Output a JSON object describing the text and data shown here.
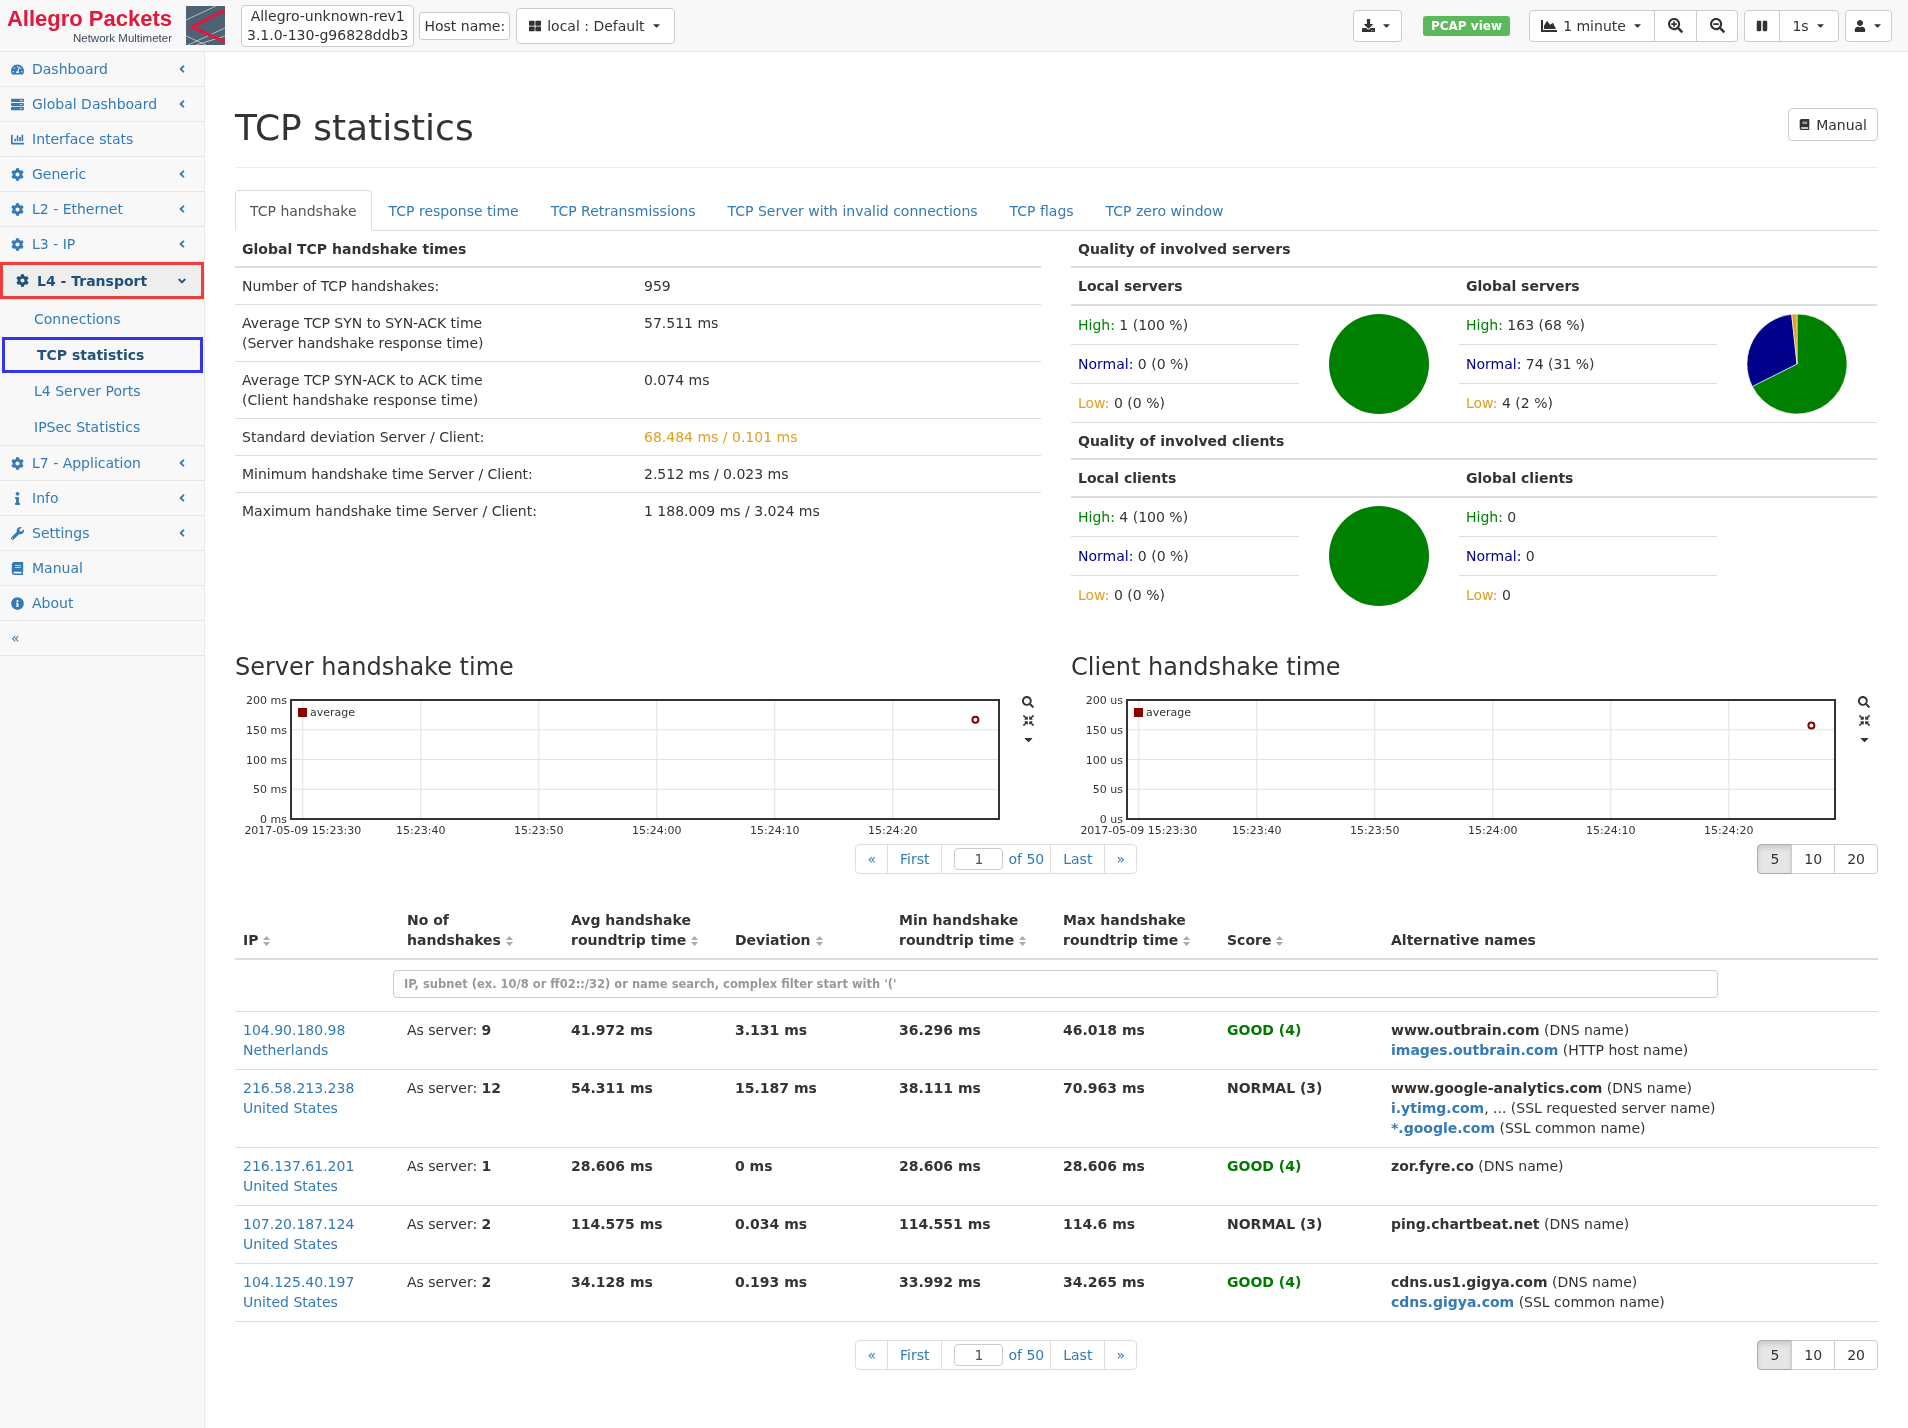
{
  "header": {
    "brand": {
      "name": "Allegro Packets",
      "tagline": "Network Multimeter"
    },
    "device": {
      "name": "Allegro-unknown-rev1",
      "version": "3.1.0-130-g96828ddb3"
    },
    "host_label": "Host name:",
    "host_select": "local : Default",
    "pcap_view": "PCAP view",
    "timespan": "1 minute",
    "refresh_interval": "1s"
  },
  "sidebar": {
    "items": [
      {
        "label": "Dashboard",
        "kind": "group",
        "expanded": false
      },
      {
        "label": "Global Dashboard",
        "kind": "group",
        "expanded": false
      },
      {
        "label": "Interface stats",
        "kind": "link"
      },
      {
        "label": "Generic",
        "kind": "group",
        "expanded": false
      },
      {
        "label": "L2 - Ethernet",
        "kind": "group",
        "expanded": false
      },
      {
        "label": "L3 - IP",
        "kind": "group",
        "expanded": false
      },
      {
        "label": "L4 - Transport",
        "kind": "group",
        "expanded": true,
        "color": "#f03c3c",
        "children": [
          {
            "label": "Connections",
            "selected": false
          },
          {
            "label": "TCP statistics",
            "selected": true,
            "color": "#3434ee"
          },
          {
            "label": "L4 Server Ports",
            "selected": false
          },
          {
            "label": "IPSec Statistics",
            "selected": false
          }
        ]
      },
      {
        "label": "L7 - Application",
        "kind": "group",
        "expanded": false
      },
      {
        "label": "Info",
        "kind": "group",
        "expanded": false
      },
      {
        "label": "Settings",
        "kind": "group",
        "expanded": false
      },
      {
        "label": "Manual",
        "kind": "link"
      },
      {
        "label": "About",
        "kind": "link"
      }
    ],
    "collapse": "«"
  },
  "page": {
    "title": "TCP statistics",
    "manual_button": "Manual"
  },
  "tabs": [
    {
      "label": "TCP handshake",
      "selected": true
    },
    {
      "label": "TCP response time",
      "selected": false
    },
    {
      "label": "TCP Retransmissions",
      "selected": false
    },
    {
      "label": "TCP Server with invalid connections",
      "selected": false
    },
    {
      "label": "TCP flags",
      "selected": false
    },
    {
      "label": "TCP zero window",
      "selected": false
    }
  ],
  "handshake_times": {
    "title": "Global TCP handshake times",
    "rows": [
      {
        "label": "Number of TCP handshakes:",
        "value": "959",
        "warning": false
      },
      {
        "label": "Average TCP SYN to SYN-ACK time",
        "note": "(Server handshake response time)",
        "value": "57.511 ms",
        "warning": false
      },
      {
        "label": "Average TCP SYN-ACK to ACK time",
        "note": "(Client handshake response time)",
        "value": "0.074 ms",
        "warning": false
      },
      {
        "label": "Standard deviation Server / Client:",
        "value": "68.484 ms / 0.101 ms",
        "warning": true
      },
      {
        "label": "Minimum handshake time Server / Client:",
        "value": "2.512 ms / 0.023 ms",
        "warning": false
      },
      {
        "label": "Maximum handshake time Server / Client:",
        "value": "1 188.009 ms / 3.024 ms",
        "warning": false
      }
    ]
  },
  "quality": [
    {
      "title": "Quality of involved servers",
      "groups": [
        {
          "title": "Local servers",
          "rows": [
            {
              "label": "High:",
              "value": "1 (100 %)",
              "color": "#008000"
            },
            {
              "label": "Normal:",
              "value": "0 (0 %)",
              "color": "#00008b"
            },
            {
              "label": "Low:",
              "value": "0 (0 %)",
              "color": "#e0a020"
            }
          ],
          "chart_data": {
            "type": "pie",
            "values": [
              100,
              0,
              0
            ]
          }
        },
        {
          "title": "Global servers",
          "rows": [
            {
              "label": "High:",
              "value": "163 (68 %)",
              "color": "#008000"
            },
            {
              "label": "Normal:",
              "value": "74 (31 %)",
              "color": "#00008b"
            },
            {
              "label": "Low:",
              "value": "4 (2 %)",
              "color": "#e0a020"
            }
          ],
          "chart_data": {
            "type": "pie",
            "values": [
              67.6,
              30.7,
              1.7
            ]
          }
        }
      ]
    },
    {
      "title": "Quality of involved clients",
      "groups": [
        {
          "title": "Local clients",
          "rows": [
            {
              "label": "High:",
              "value": "4 (100 %)",
              "color": "#008000"
            },
            {
              "label": "Normal:",
              "value": "0 (0 %)",
              "color": "#00008b"
            },
            {
              "label": "Low:",
              "value": "0 (0 %)",
              "color": "#e0a020"
            }
          ],
          "chart_data": {
            "type": "pie",
            "values": [
              100,
              0,
              0
            ]
          }
        },
        {
          "title": "Global clients",
          "rows": [
            {
              "label": "High:",
              "value": "0",
              "color": "#008000"
            },
            {
              "label": "Normal:",
              "value": "0",
              "color": "#00008b"
            },
            {
              "label": "Low:",
              "value": "0",
              "color": "#e0a020"
            }
          ]
        }
      ]
    }
  ],
  "charts": [
    {
      "title": "Server handshake time",
      "chart_data": {
        "type": "scatter",
        "grid": true,
        "categories": [
          "2017-05-09 15:23:30",
          null,
          null,
          null,
          null,
          null,
          null,
          null,
          null,
          null,
          "15:23:40",
          null,
          null,
          null,
          null,
          null,
          null,
          null,
          null,
          null,
          "15:23:50",
          null,
          null,
          null,
          null,
          null,
          null,
          null,
          null,
          null,
          "15:24:00",
          null,
          null,
          null,
          null,
          null,
          null,
          null,
          null,
          null,
          "15:24:10",
          null,
          null,
          null,
          null,
          null,
          null,
          null,
          null,
          null,
          "15:24:20",
          null,
          null,
          null,
          null,
          null,
          null,
          null,
          null,
          null
        ],
        "series": [
          {
            "name": "average",
            "color": "#8b0000",
            "values": [
              null,
              null,
              null,
              null,
              null,
              null,
              null,
              null,
              null,
              null,
              null,
              null,
              null,
              null,
              null,
              null,
              null,
              null,
              null,
              null,
              null,
              null,
              null,
              null,
              null,
              null,
              null,
              null,
              null,
              null,
              null,
              null,
              null,
              null,
              null,
              null,
              null,
              null,
              null,
              null,
              null,
              null,
              null,
              null,
              null,
              null,
              null,
              null,
              null,
              null,
              null,
              null,
              null,
              null,
              null,
              null,
              null,
              167,
              null,
              null
            ]
          }
        ],
        "ylim": [
          0,
          200
        ],
        "yticks": [
          {
            "value": 0,
            "label": "0 ms"
          },
          {
            "value": 50,
            "label": "50 ms"
          },
          {
            "value": 100,
            "label": "100 ms"
          },
          {
            "value": 150,
            "label": "150 ms"
          },
          {
            "value": 200,
            "label": "200 ms"
          }
        ]
      }
    },
    {
      "title": "Client handshake time",
      "chart_data": {
        "type": "scatter",
        "grid": true,
        "categories": [
          "2017-05-09 15:23:30",
          null,
          null,
          null,
          null,
          null,
          null,
          null,
          null,
          null,
          "15:23:40",
          null,
          null,
          null,
          null,
          null,
          null,
          null,
          null,
          null,
          "15:23:50",
          null,
          null,
          null,
          null,
          null,
          null,
          null,
          null,
          null,
          "15:24:00",
          null,
          null,
          null,
          null,
          null,
          null,
          null,
          null,
          null,
          "15:24:10",
          null,
          null,
          null,
          null,
          null,
          null,
          null,
          null,
          null,
          "15:24:20",
          null,
          null,
          null,
          null,
          null,
          null,
          null,
          null,
          null
        ],
        "series": [
          {
            "name": "average",
            "color": "#8b0000",
            "values": [
              null,
              null,
              null,
              null,
              null,
              null,
              null,
              null,
              null,
              null,
              null,
              null,
              null,
              null,
              null,
              null,
              null,
              null,
              null,
              null,
              null,
              null,
              null,
              null,
              null,
              null,
              null,
              null,
              null,
              null,
              null,
              null,
              null,
              null,
              null,
              null,
              null,
              null,
              null,
              null,
              null,
              null,
              null,
              null,
              null,
              null,
              null,
              null,
              null,
              null,
              null,
              null,
              null,
              null,
              null,
              null,
              null,
              157,
              null,
              null
            ]
          }
        ],
        "ylim": [
          0,
          200
        ],
        "yticks": [
          {
            "value": 0,
            "label": "0 us"
          },
          {
            "value": 50,
            "label": "50 us"
          },
          {
            "value": 100,
            "label": "100 us"
          },
          {
            "value": 150,
            "label": "150 us"
          },
          {
            "value": 200,
            "label": "200 us"
          }
        ]
      }
    }
  ],
  "pagination_top": {
    "prev": "«",
    "first": "First",
    "page": "1",
    "total": "of 50",
    "last": "Last",
    "next": "»",
    "sizes": [
      {
        "label": "5",
        "selected": true
      },
      {
        "label": "10",
        "selected": false
      },
      {
        "label": "20",
        "selected": false
      }
    ]
  },
  "table": {
    "columns": [
      {
        "label": "IP",
        "sortable": true
      },
      {
        "label": "No of handshakes",
        "sortable": true
      },
      {
        "label": "Avg handshake roundtrip time",
        "sortable": true
      },
      {
        "label": "Deviation",
        "sortable": true
      },
      {
        "label": "Min handshake roundtrip time",
        "sortable": true
      },
      {
        "label": "Max handshake roundtrip time",
        "sortable": true
      },
      {
        "label": "Score",
        "sortable": true
      },
      {
        "label": "Alternative names",
        "sortable": false
      }
    ],
    "filter_placeholder": "IP, subnet (ex. 10/8 or ff02::/32) or name search, complex filter start with '('",
    "rows": [
      {
        "ip": "104.90.180.98",
        "country": "Netherlands",
        "handshakes": "As server: **9**",
        "avg": "41.972 ms",
        "deviation": "3.131 ms",
        "min": "36.296 ms",
        "max": "46.018 ms",
        "score": {
          "label": "GOOD (4)",
          "kind": "good"
        },
        "names": [
          {
            "host": "www.outbrain.com",
            "link": false,
            "note": " (DNS name)"
          },
          {
            "host": "images.outbrain.com",
            "link": true,
            "note": " (HTTP host name)"
          }
        ]
      },
      {
        "ip": "216.58.213.238",
        "country": "United States",
        "handshakes": "As server: **12**",
        "avg": "54.311 ms",
        "deviation": "15.187 ms",
        "min": "38.111 ms",
        "max": "70.963 ms",
        "score": {
          "label": "NORMAL (3)",
          "kind": "normal"
        },
        "names": [
          {
            "host": "www.google-analytics.com",
            "link": false,
            "note": " (DNS name)"
          },
          {
            "host": "i.ytimg.com",
            "link": true,
            "note": ", ... (SSL requested server name)"
          },
          {
            "host": "*.google.com",
            "link": true,
            "note": " (SSL common name)"
          }
        ]
      },
      {
        "ip": "216.137.61.201",
        "country": "United States",
        "handshakes": "As server: **1**",
        "avg": "28.606 ms",
        "deviation": "0 ms",
        "min": "28.606 ms",
        "max": "28.606 ms",
        "score": {
          "label": "GOOD (4)",
          "kind": "good"
        },
        "names": [
          {
            "host": "zor.fyre.co",
            "link": false,
            "note": " (DNS name)"
          }
        ]
      },
      {
        "ip": "107.20.187.124",
        "country": "United States",
        "handshakes": "As server: **2**",
        "avg": "114.575 ms",
        "deviation": "0.034 ms",
        "min": "114.551 ms",
        "max": "114.6 ms",
        "score": {
          "label": "NORMAL (3)",
          "kind": "normal"
        },
        "names": [
          {
            "host": "ping.chartbeat.net",
            "link": false,
            "note": " (DNS name)"
          }
        ]
      },
      {
        "ip": "104.125.40.197",
        "country": "United States",
        "handshakes": "As server: **2**",
        "avg": "34.128 ms",
        "deviation": "0.193 ms",
        "min": "33.992 ms",
        "max": "34.265 ms",
        "score": {
          "label": "GOOD (4)",
          "kind": "good"
        },
        "names": [
          {
            "host": "cdns.us1.gigya.com",
            "link": false,
            "note": " (DNS name)"
          },
          {
            "host": "cdns.gigya.com",
            "link": true,
            "note": " (SSL common name)"
          }
        ]
      }
    ]
  },
  "pagination_bottom": {
    "prev": "«",
    "first": "First",
    "page": "1",
    "total": "of 50",
    "last": "Last",
    "next": "»",
    "sizes": [
      {
        "label": "5",
        "selected": true
      },
      {
        "label": "10",
        "selected": false
      },
      {
        "label": "20",
        "selected": false
      }
    ]
  }
}
